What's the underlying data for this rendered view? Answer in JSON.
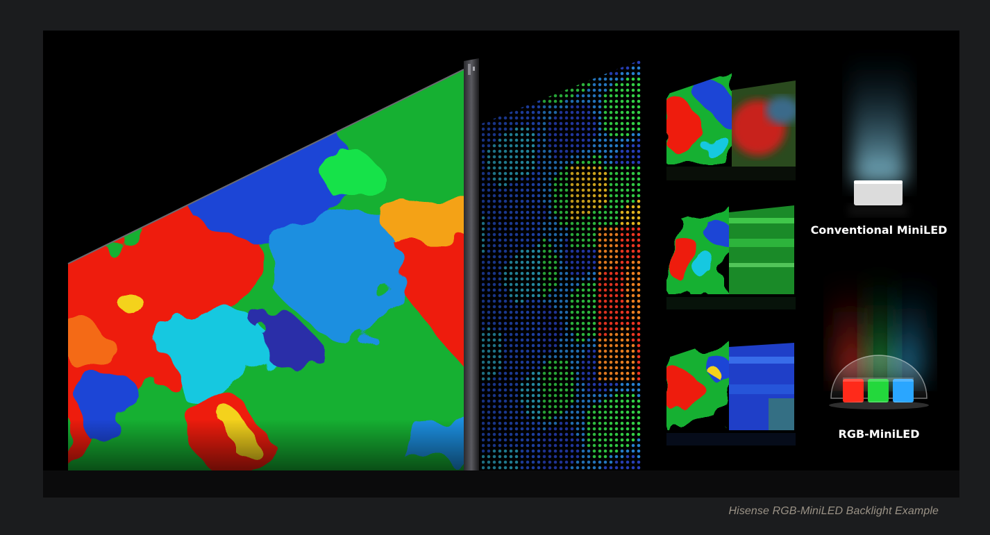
{
  "figure": {
    "labels": {
      "conventional": "Conventional MiniLED",
      "rgb": "RGB-MiniLED"
    }
  },
  "caption": "Hisense RGB-MiniLED Backlight Example",
  "colors": {
    "page_background": "#1b1c1e",
    "figure_background": "#000000",
    "caption": "#9a9286",
    "led_red": "#ff2a1a",
    "led_green": "#23d83c",
    "led_blue": "#2aa6ff"
  }
}
